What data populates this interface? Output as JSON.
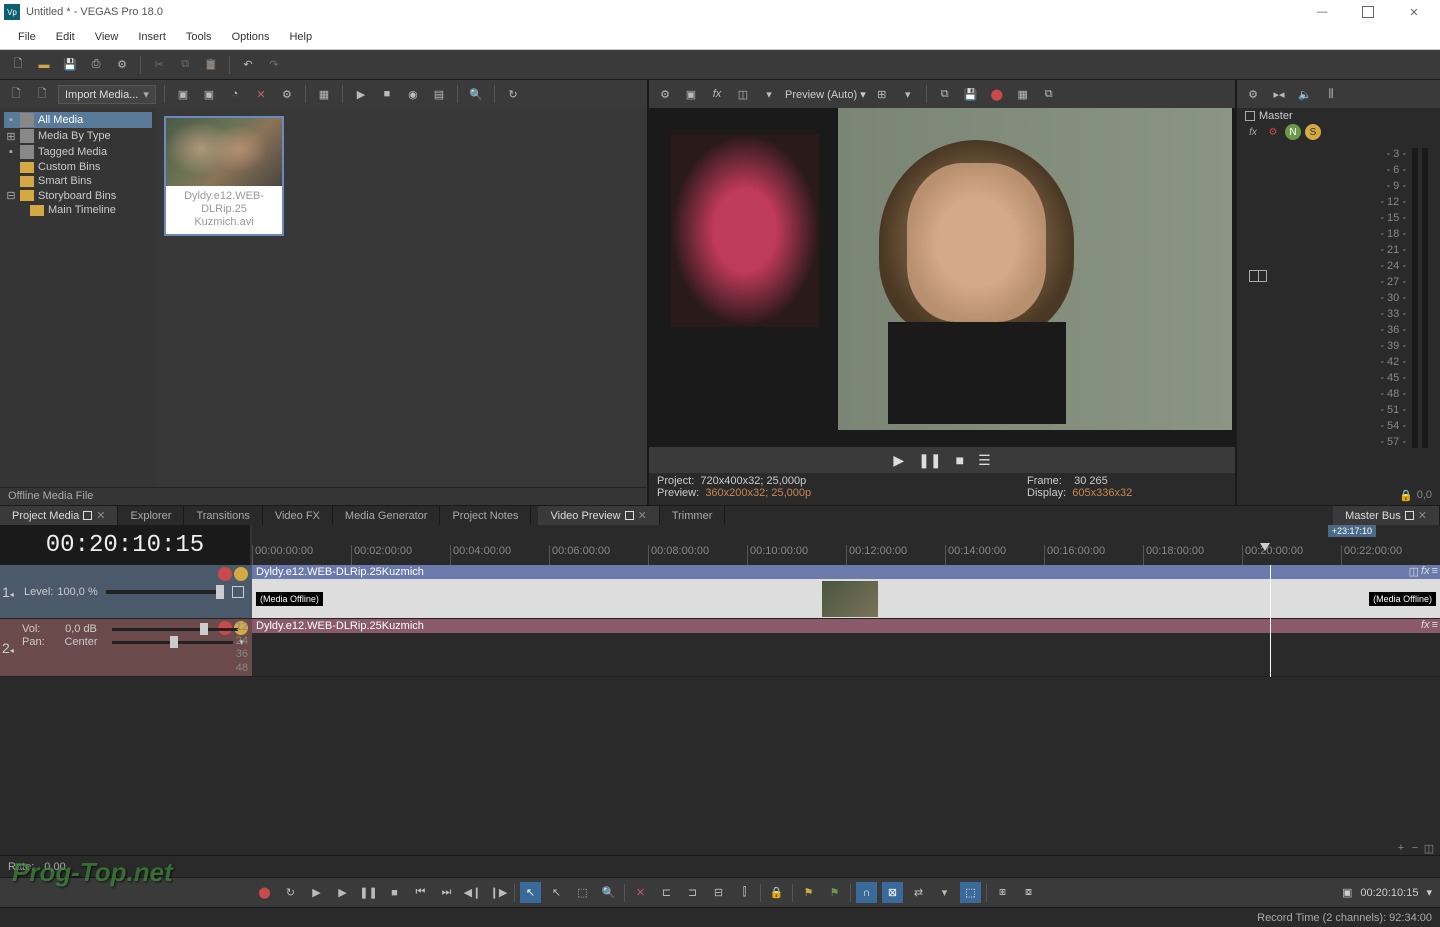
{
  "window": {
    "title": "Untitled * - VEGAS Pro 18.0",
    "app_abbrev": "Vp"
  },
  "menu": [
    "File",
    "Edit",
    "View",
    "Insert",
    "Tools",
    "Options",
    "Help"
  ],
  "media_panel": {
    "import_label": "Import Media...",
    "tree": {
      "all_media": "All Media",
      "by_type": "Media By Type",
      "tagged": "Tagged Media",
      "custom_bins": "Custom Bins",
      "smart_bins": "Smart Bins",
      "storyboard_bins": "Storyboard Bins",
      "main_timeline": "Main Timeline"
    },
    "thumb_label_1": "Dyldy.e12.WEB-DLRip.25",
    "thumb_label_2": "Kuzmich.avi",
    "status": "Offline Media File"
  },
  "preview": {
    "mode_label": "Preview (Auto)",
    "info": {
      "project_label": "Project:",
      "project_value": "720x400x32; 25,000p",
      "preview_label": "Preview:",
      "preview_value": "360x200x32; 25,000p",
      "frame_label": "Frame:",
      "frame_value": "30 265",
      "display_label": "Display:",
      "display_value": "605x336x32"
    }
  },
  "master": {
    "title": "Master",
    "db_labels": [
      "- 3 -",
      "- 6 -",
      "- 9 -",
      "- 12 -",
      "- 15 -",
      "- 18 -",
      "- 21 -",
      "- 24 -",
      "- 27 -",
      "- 30 -",
      "- 33 -",
      "- 36 -",
      "- 39 -",
      "- 42 -",
      "- 45 -",
      "- 48 -",
      "- 51 -",
      "- 54 -",
      "- 57 -"
    ],
    "lock_value": "0,0"
  },
  "tabs_upper": {
    "project_media": "Project Media",
    "explorer": "Explorer",
    "transitions": "Transitions",
    "video_fx": "Video FX",
    "media_generator": "Media Generator",
    "project_notes": "Project Notes",
    "video_preview": "Video Preview",
    "trimmer": "Trimmer",
    "master_bus": "Master Bus"
  },
  "timeline": {
    "time": "00:20:10:15",
    "marker": "+23:17:10",
    "ruler": [
      "00:00:00:00",
      "00:02:00:00",
      "00:04:00:00",
      "00:06:00:00",
      "00:08:00:00",
      "00:10:00:00",
      "00:12:00:00",
      "00:14:00:00",
      "00:16:00:00",
      "00:18:00:00",
      "00:20:00:00",
      "00:22:00:00"
    ],
    "track1": {
      "level_label": "Level:",
      "level_value": "100,0 %"
    },
    "track2": {
      "vol_label": "Vol:",
      "vol_value": "0,0 dB",
      "pan_label": "Pan:",
      "pan_value": "Center",
      "db_marks": [
        "12",
        "24",
        "36",
        "48"
      ]
    },
    "clip_name": "Dyldy.e12.WEB-DLRip.25Kuzmich",
    "offline_text": "(Media Offline)"
  },
  "rate": {
    "label": "Rate:",
    "value": "0,00"
  },
  "bottom": {
    "time": "00:20:10:15"
  },
  "status": {
    "record_time": "Record Time (2 channels): 92:34:00"
  },
  "watermark": "Prog-Top.net"
}
